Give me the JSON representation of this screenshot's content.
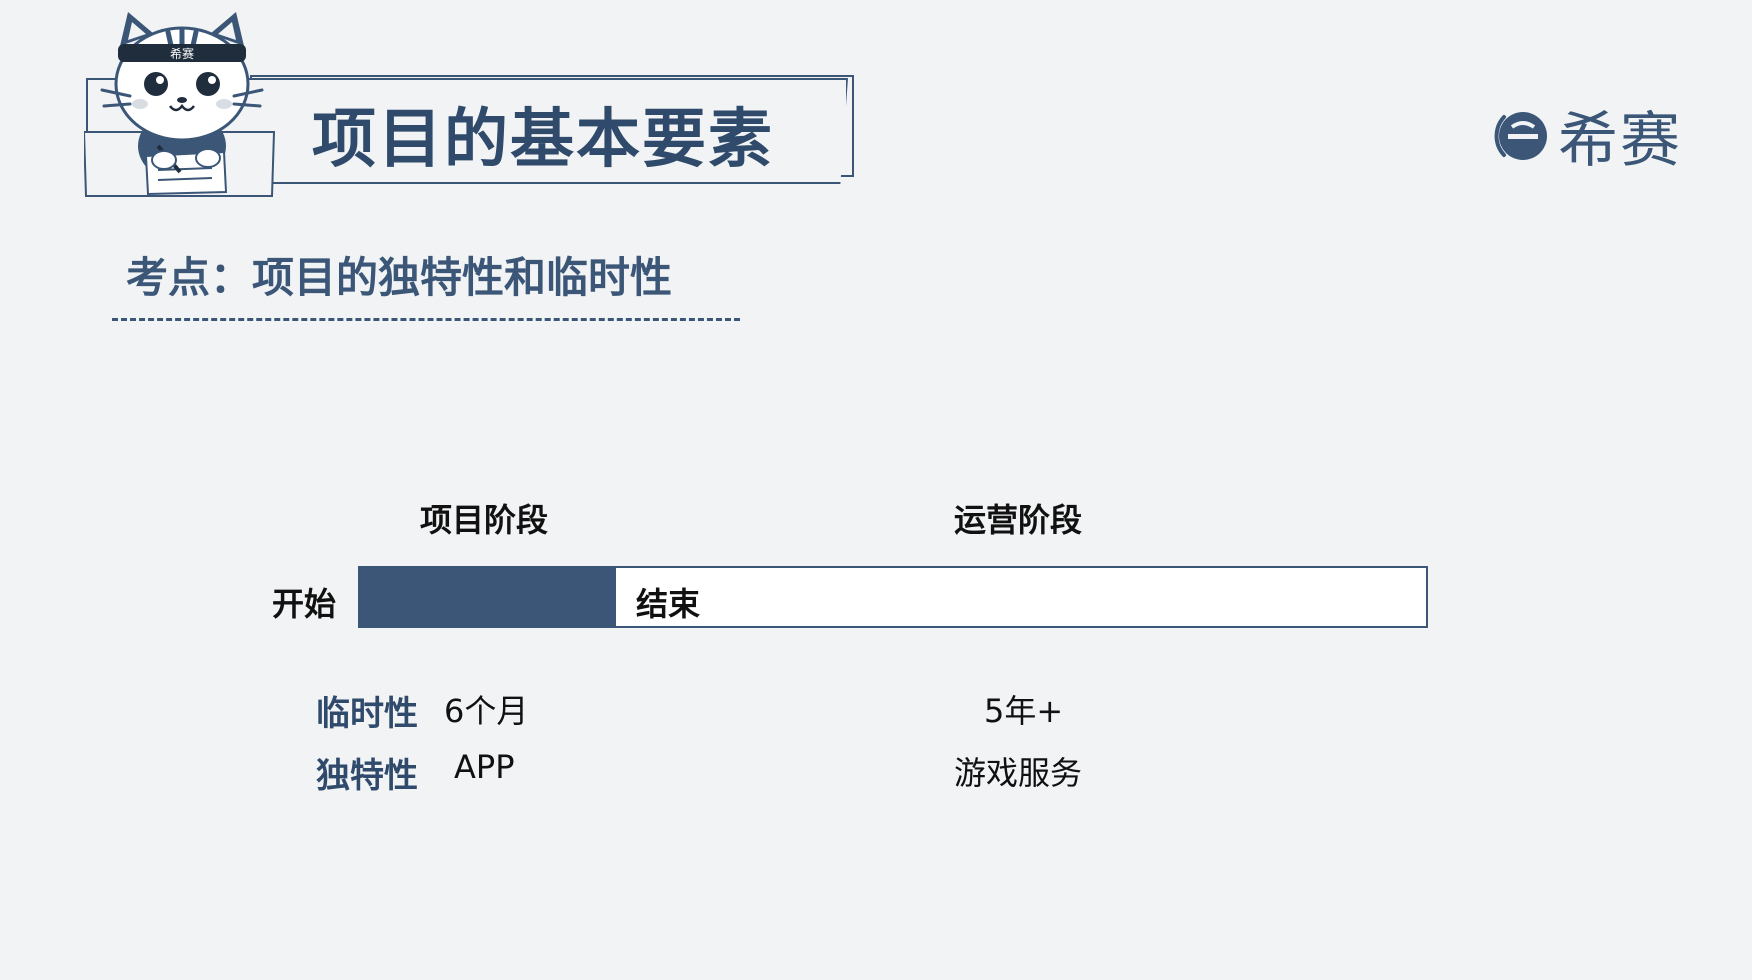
{
  "header": {
    "title": "项目的基本要素",
    "mascot_headband_text": "希赛"
  },
  "brand": {
    "name": "希赛",
    "icon": "brand-e-logo-icon",
    "color": "#3b5677"
  },
  "key_point": {
    "text": "考点：项目的独特性和临时性"
  },
  "timeline": {
    "phases": [
      {
        "label": "项目阶段"
      },
      {
        "label": "运营阶段"
      }
    ],
    "start_label": "开始",
    "end_label": "结束",
    "project_fill_color": "#3b5677"
  },
  "attributes": [
    {
      "label": "临时性",
      "project_value": "6个月",
      "operations_value": "5年+"
    },
    {
      "label": "独特性",
      "project_value": "APP",
      "operations_value": "游戏服务"
    }
  ],
  "colors": {
    "background": "#f1f3f5",
    "accent": "#3b5677"
  }
}
